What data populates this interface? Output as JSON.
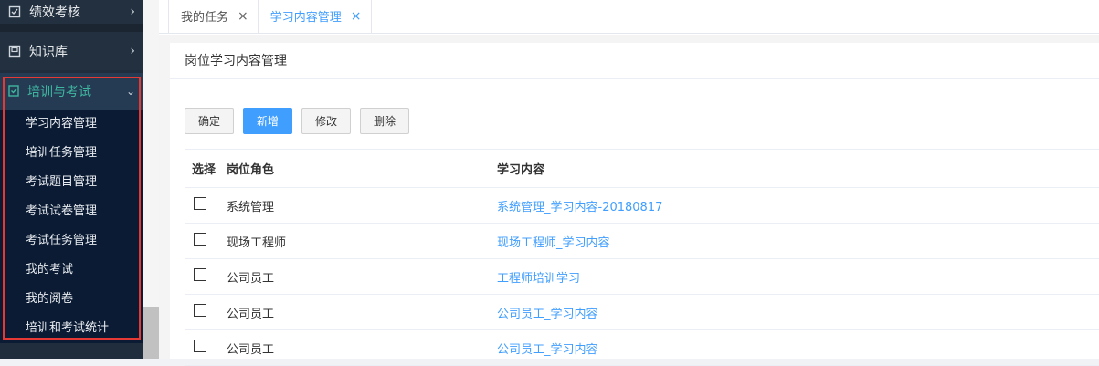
{
  "sidebar": {
    "top_items": [
      {
        "label": "绩效考核",
        "icon": "clipboard-icon"
      },
      {
        "label": "知识库",
        "icon": "book-icon"
      }
    ],
    "group": {
      "label": "培训与考试",
      "icon": "training-icon",
      "items": [
        {
          "label": "学习内容管理"
        },
        {
          "label": "培训任务管理"
        },
        {
          "label": "考试题目管理"
        },
        {
          "label": "考试试卷管理"
        },
        {
          "label": "考试任务管理"
        },
        {
          "label": "我的考试"
        },
        {
          "label": "我的阅卷"
        },
        {
          "label": "培训和考试统计"
        }
      ]
    }
  },
  "tabs": [
    {
      "label": "我的任务",
      "close": "×",
      "active": false
    },
    {
      "label": "学习内容管理",
      "close": "×",
      "active": true
    }
  ],
  "panel": {
    "title": "岗位学习内容管理",
    "buttons": {
      "confirm": "确定",
      "add": "新增",
      "edit": "修改",
      "delete": "删除"
    }
  },
  "table": {
    "headers": {
      "select": "选择",
      "role": "岗位角色",
      "content": "学习内容"
    },
    "rows": [
      {
        "role": "系统管理",
        "content": "系统管理_学习内容-20180817"
      },
      {
        "role": "现场工程师",
        "content": "现场工程师_学习内容"
      },
      {
        "role": "公司员工",
        "content": "工程师培训学习"
      },
      {
        "role": "公司员工",
        "content": "公司员工_学习内容"
      },
      {
        "role": "公司员工",
        "content": "公司员工_学习内容"
      }
    ]
  },
  "colors": {
    "accent": "#409eff",
    "sidebar_bg": "#1f2d3d",
    "active_group_text": "#3fb6a0",
    "highlight": "#e53935"
  }
}
